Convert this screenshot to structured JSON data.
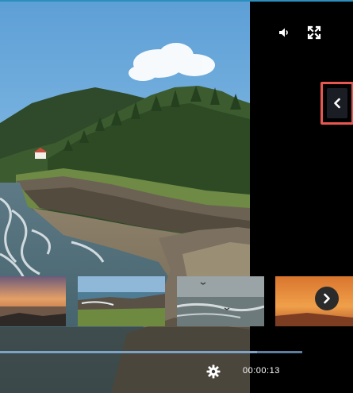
{
  "player": {
    "time_display": "00:00:13",
    "progress_fraction": 0.85,
    "colors": {
      "accent_border": "#e8574f",
      "progress": "#7fa3c7",
      "panel": "#000000"
    }
  },
  "controls": {
    "volume_icon": "speaker-icon",
    "fullscreen_icon": "fullscreen-expand-icon",
    "collapse_icon": "chevron-left-icon",
    "settings_icon": "gear-icon",
    "next_icon": "chevron-right-icon"
  },
  "thumbnails": [
    {
      "name": "sunset-coast-thumb"
    },
    {
      "name": "rocky-shore-thumb"
    },
    {
      "name": "surf-birds-thumb"
    },
    {
      "name": "orange-sky-thumb"
    }
  ]
}
